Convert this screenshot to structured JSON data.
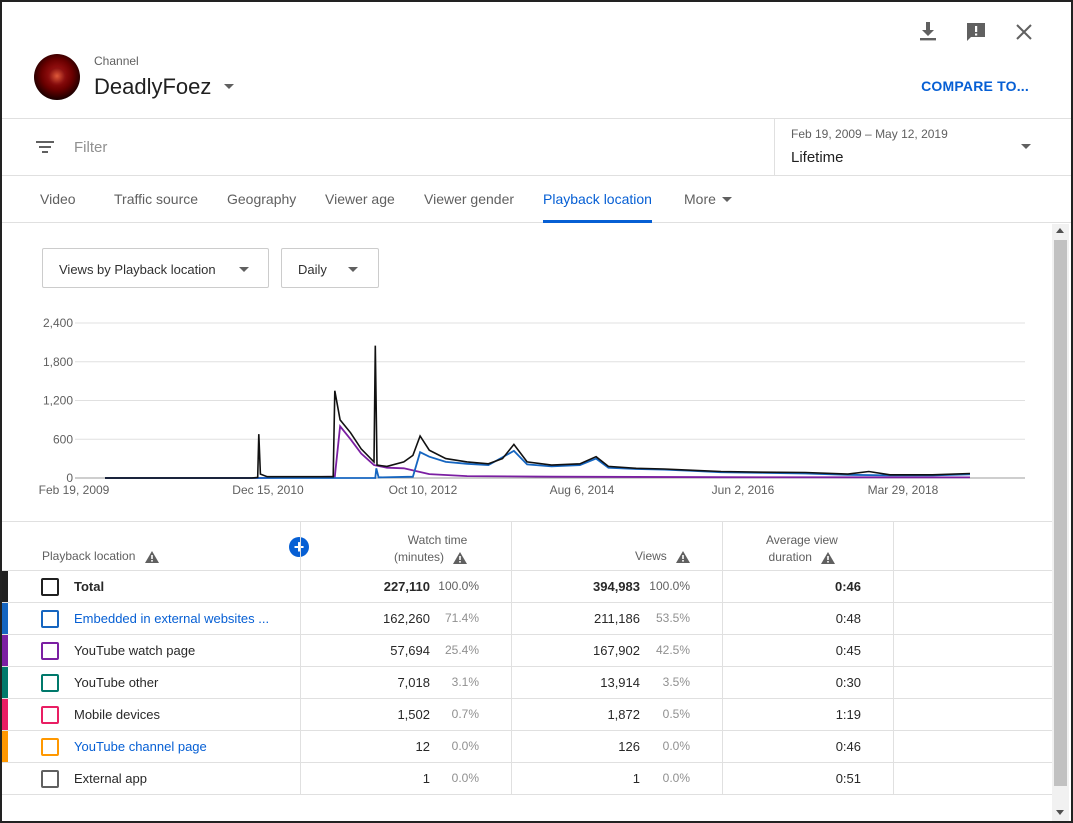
{
  "header": {
    "channel_label": "Channel",
    "channel_name": "DeadlyFoez",
    "compare_label": "COMPARE TO..."
  },
  "filter": {
    "placeholder": "Filter",
    "date_range": "Feb 19, 2009 – May 12, 2019",
    "period": "Lifetime"
  },
  "tabs": [
    {
      "label": "Video"
    },
    {
      "label": "Traffic source"
    },
    {
      "label": "Geography"
    },
    {
      "label": "Viewer age"
    },
    {
      "label": "Viewer gender"
    },
    {
      "label": "Playback location",
      "active": true
    },
    {
      "label": "More"
    }
  ],
  "controls": {
    "metric_select": "Views by Playback location",
    "interval_select": "Daily"
  },
  "chart_data": {
    "type": "line",
    "ylim": [
      0,
      2400
    ],
    "y_ticks": [
      "2,400",
      "1,800",
      "1,200",
      "600",
      "0"
    ],
    "x_ticks": [
      "Feb 19, 2009",
      "Dec 15, 2010",
      "Oct 10, 2012",
      "Aug 6, 2014",
      "Jun 2, 2016",
      "Mar 29, 2018"
    ],
    "x_range": [
      "2009-02-19",
      "2019-05-12"
    ],
    "series": [
      {
        "color": "#111111",
        "points": [
          [
            "2009-02-19",
            0
          ],
          [
            "2010-11-15",
            0
          ],
          [
            "2010-12-10",
            10
          ],
          [
            "2010-12-15",
            680
          ],
          [
            "2010-12-22",
            60
          ],
          [
            "2011-01-20",
            20
          ],
          [
            "2011-06-01",
            20
          ],
          [
            "2011-11-01",
            20
          ],
          [
            "2011-11-08",
            1350
          ],
          [
            "2011-12-01",
            900
          ],
          [
            "2012-01-15",
            700
          ],
          [
            "2012-03-01",
            450
          ],
          [
            "2012-04-25",
            250
          ],
          [
            "2012-05-01",
            2050
          ],
          [
            "2012-05-08",
            200
          ],
          [
            "2012-06-20",
            180
          ],
          [
            "2012-09-01",
            250
          ],
          [
            "2012-10-10",
            350
          ],
          [
            "2012-11-10",
            650
          ],
          [
            "2012-12-20",
            430
          ],
          [
            "2013-03-01",
            300
          ],
          [
            "2013-06-01",
            250
          ],
          [
            "2013-09-01",
            220
          ],
          [
            "2013-11-01",
            300
          ],
          [
            "2013-12-20",
            520
          ],
          [
            "2014-02-15",
            250
          ],
          [
            "2014-06-01",
            200
          ],
          [
            "2014-10-01",
            220
          ],
          [
            "2014-12-10",
            330
          ],
          [
            "2015-02-01",
            180
          ],
          [
            "2015-06-01",
            150
          ],
          [
            "2015-10-01",
            140
          ],
          [
            "2016-02-01",
            120
          ],
          [
            "2016-06-01",
            100
          ],
          [
            "2016-12-01",
            90
          ],
          [
            "2017-06-01",
            85
          ],
          [
            "2017-12-01",
            60
          ],
          [
            "2018-03-01",
            100
          ],
          [
            "2018-06-01",
            50
          ],
          [
            "2018-12-01",
            50
          ],
          [
            "2019-05-12",
            70
          ]
        ]
      },
      {
        "color": "#1565c0",
        "points": [
          [
            "2009-02-19",
            0
          ],
          [
            "2012-05-01",
            0
          ],
          [
            "2012-05-05",
            150
          ],
          [
            "2012-05-15",
            10
          ],
          [
            "2012-10-10",
            20
          ],
          [
            "2012-11-10",
            400
          ],
          [
            "2012-12-20",
            330
          ],
          [
            "2013-03-01",
            250
          ],
          [
            "2013-06-01",
            220
          ],
          [
            "2013-09-01",
            200
          ],
          [
            "2013-12-20",
            420
          ],
          [
            "2014-02-15",
            210
          ],
          [
            "2014-06-01",
            180
          ],
          [
            "2014-10-01",
            200
          ],
          [
            "2014-12-10",
            300
          ],
          [
            "2015-02-01",
            160
          ],
          [
            "2015-06-01",
            140
          ],
          [
            "2015-10-01",
            130
          ],
          [
            "2016-02-01",
            110
          ],
          [
            "2016-06-01",
            90
          ],
          [
            "2016-12-01",
            80
          ],
          [
            "2017-06-01",
            70
          ],
          [
            "2017-12-01",
            50
          ],
          [
            "2018-06-01",
            40
          ],
          [
            "2018-12-01",
            40
          ],
          [
            "2019-05-12",
            55
          ]
        ]
      },
      {
        "color": "#7b1fa2",
        "points": [
          [
            "2009-02-19",
            0
          ],
          [
            "2010-12-15",
            0
          ],
          [
            "2011-11-08",
            20
          ],
          [
            "2011-12-01",
            800
          ],
          [
            "2012-01-15",
            600
          ],
          [
            "2012-03-01",
            380
          ],
          [
            "2012-04-25",
            200
          ],
          [
            "2012-06-20",
            160
          ],
          [
            "2012-09-01",
            150
          ],
          [
            "2012-12-20",
            60
          ],
          [
            "2013-06-01",
            30
          ],
          [
            "2014-06-01",
            20
          ],
          [
            "2016-06-01",
            12
          ],
          [
            "2019-05-12",
            10
          ]
        ]
      }
    ]
  },
  "table": {
    "headers": {
      "location": "Playback location",
      "watch_time_line1": "Watch time",
      "watch_time_line2": "(minutes)",
      "views": "Views",
      "avg_line1": "Average view",
      "avg_line2": "duration"
    },
    "rows": [
      {
        "name": "Total",
        "color": "#202020",
        "watch": "227,110",
        "watch_pct": "100.0%",
        "views": "394,983",
        "views_pct": "100.0%",
        "avg": "0:46",
        "box": "#202020"
      },
      {
        "name": "Embedded in external websites ...",
        "color": "#1565c0",
        "watch": "162,260",
        "watch_pct": "71.4%",
        "views": "211,186",
        "views_pct": "53.5%",
        "avg": "0:48",
        "link": true,
        "box": "#1565c0"
      },
      {
        "name": "YouTube watch page",
        "color": "#7b1fa2",
        "watch": "57,694",
        "watch_pct": "25.4%",
        "views": "167,902",
        "views_pct": "42.5%",
        "avg": "0:45",
        "box": "#7b1fa2"
      },
      {
        "name": "YouTube other",
        "color": "#00796b",
        "watch": "7,018",
        "watch_pct": "3.1%",
        "views": "13,914",
        "views_pct": "3.5%",
        "avg": "0:30",
        "box": "#00796b"
      },
      {
        "name": "Mobile devices",
        "color": "#e91e63",
        "watch": "1,502",
        "watch_pct": "0.7%",
        "views": "1,872",
        "views_pct": "0.5%",
        "avg": "1:19",
        "box": "#e91e63"
      },
      {
        "name": "YouTube channel page",
        "color": "#ff9800",
        "watch": "12",
        "watch_pct": "0.0%",
        "views": "126",
        "views_pct": "0.0%",
        "avg": "0:46",
        "link": true,
        "box": "#ff9800"
      },
      {
        "name": "External app",
        "color": "#ffffff",
        "watch": "1",
        "watch_pct": "0.0%",
        "views": "1",
        "views_pct": "0.0%",
        "avg": "0:51",
        "box": "#606060"
      }
    ]
  },
  "colors": {
    "accent": "#065fd4"
  }
}
